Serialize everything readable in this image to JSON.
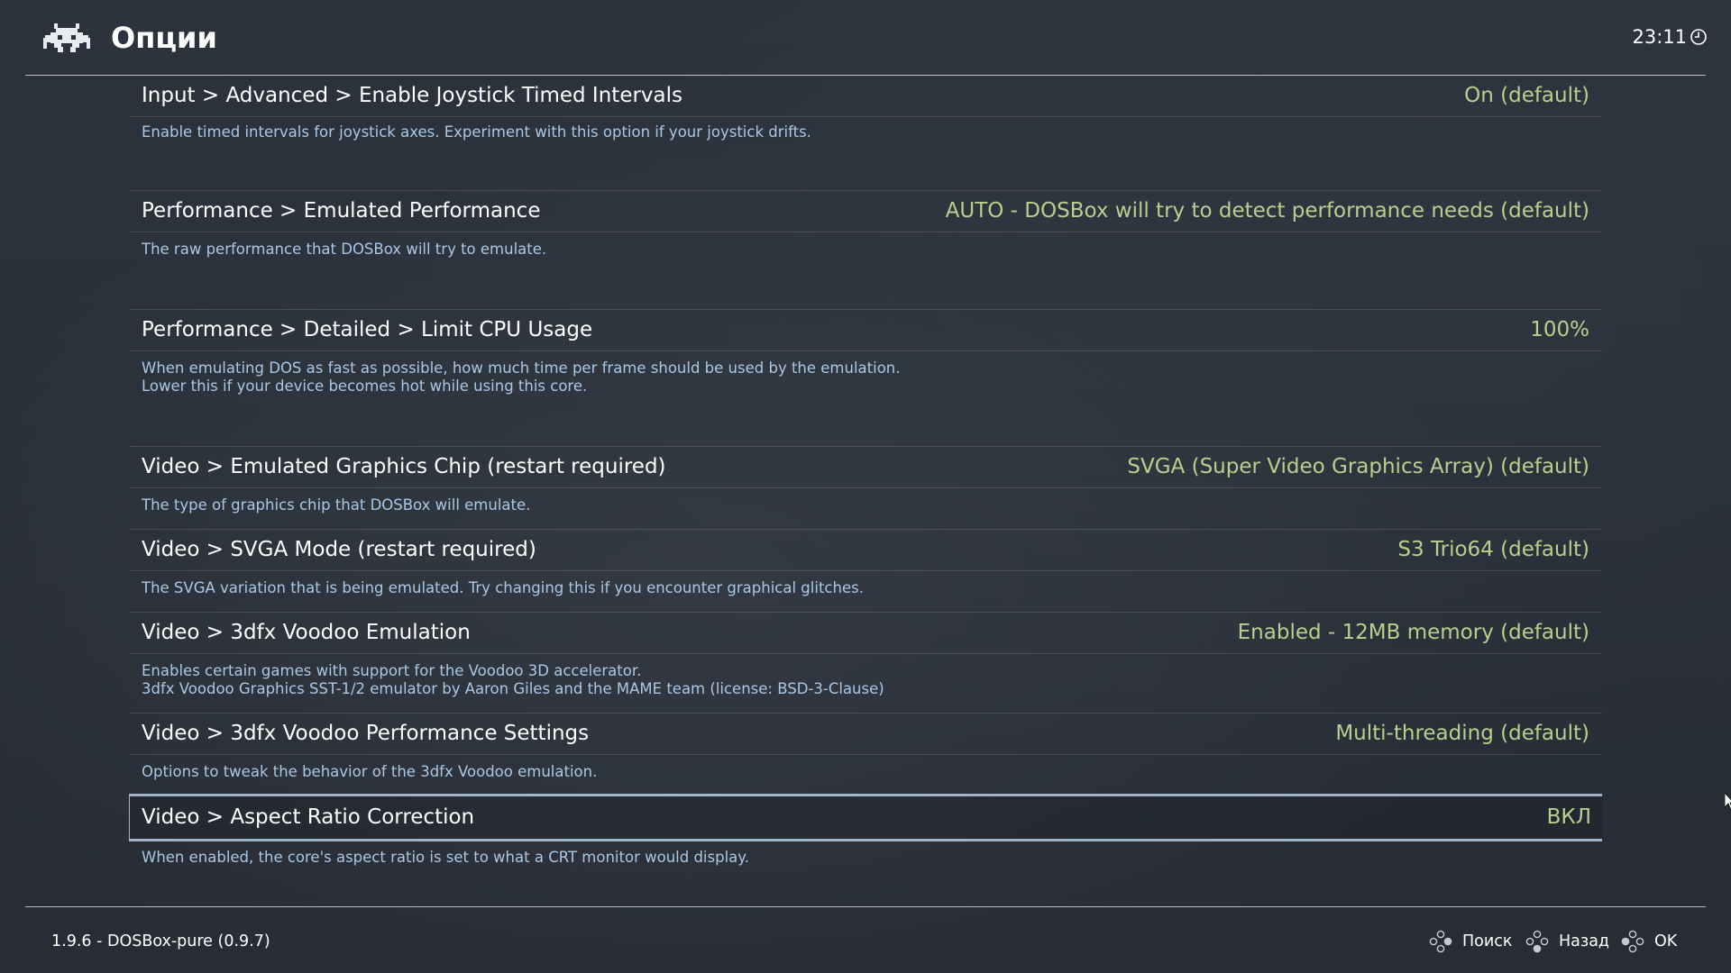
{
  "header": {
    "title": "Опции",
    "time": "23:11",
    "logo_icon": "retroarch-invader-icon",
    "clock_icon": "clock-icon"
  },
  "settings": [
    {
      "label": "Input > Advanced > Enable Joystick Timed Intervals",
      "value": "On (default)",
      "description": [
        "Enable timed intervals for joystick axes. Experiment with this option if your joystick drifts."
      ]
    },
    {
      "label": "Performance > Emulated Performance",
      "value": "AUTO - DOSBox will try to detect performance needs (default)",
      "description": [
        "The raw performance that DOSBox will try to emulate."
      ]
    },
    {
      "label": "Performance > Detailed > Limit CPU Usage",
      "value": "100%",
      "description": [
        "When emulating DOS as fast as possible, how much time per frame should be used by the emulation.",
        "Lower this if your device becomes hot while using this core."
      ]
    },
    {
      "label": "Video > Emulated Graphics Chip (restart required)",
      "value": "SVGA (Super Video Graphics Array) (default)",
      "description": [
        "The type of graphics chip that DOSBox will emulate."
      ]
    },
    {
      "label": "Video > SVGA Mode (restart required)",
      "value": "S3 Trio64 (default)",
      "description": [
        "The SVGA variation that is being emulated. Try changing this if you encounter graphical glitches."
      ]
    },
    {
      "label": "Video > 3dfx Voodoo Emulation",
      "value": "Enabled - 12MB memory (default)",
      "description": [
        "Enables certain games with support for the Voodoo 3D accelerator.",
        "3dfx Voodoo Graphics SST-1/2 emulator by Aaron Giles and the MAME team (license: BSD-3-Clause)"
      ]
    },
    {
      "label": "Video > 3dfx Voodoo Performance Settings",
      "value": "Multi-threading (default)",
      "description": [
        "Options to tweak the behavior of the 3dfx Voodoo emulation."
      ]
    },
    {
      "label": "Video > Aspect Ratio Correction",
      "value": "ВКЛ",
      "selected": true,
      "description": [
        "When enabled, the core's aspect ratio is set to what a CRT monitor would display."
      ]
    }
  ],
  "footer": {
    "core_info": "1.9.6 - DOSBox-pure (0.9.7)",
    "actions": [
      {
        "label": "Поиск",
        "icon": "gamepad-buttons-icon"
      },
      {
        "label": "Назад",
        "icon": "gamepad-buttons-icon"
      },
      {
        "label": "OK",
        "icon": "gamepad-buttons-icon"
      }
    ]
  },
  "colors": {
    "value_text": "#b7d08d",
    "description_text": "#a9c8e6",
    "selection_border": "#9fb4c4"
  }
}
